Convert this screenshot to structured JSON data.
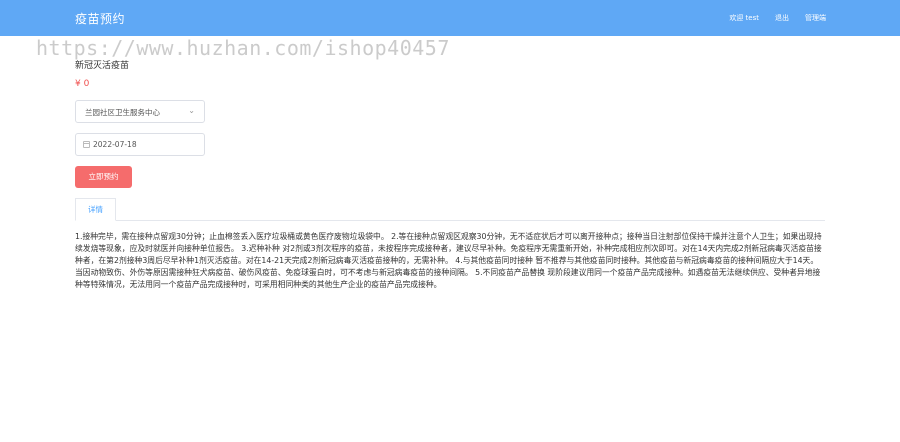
{
  "header": {
    "brand": "疫苗预约",
    "nav": {
      "welcome": "欢迎 test",
      "logout": "退出",
      "admin": "管理端"
    }
  },
  "watermark": "https://www.huzhan.com/ishop40457",
  "product": {
    "name": "新冠灭活疫苗",
    "price": "¥ 0"
  },
  "form": {
    "clinic_selected": "兰园社区卫生服务中心",
    "date_value": "2022-07-18",
    "book_label": "立即预约"
  },
  "tabs": {
    "detail_label": "详情"
  },
  "detail_text": "1.接种完毕，需在接种点留观30分钟；止血棉签丢入医疗垃圾桶或黄色医疗废物垃圾袋中。 2.等在接种点留观区观察30分钟，无不适症状后才可以离开接种点；接种当日注射部位保持干燥并注意个人卫生；如果出现持续发烧等现象，应及时就医并向接种单位报告。 3.迟种补种 对2剂或3剂次程序的疫苗，未按程序完成接种者，建议尽早补种。免疫程序无需重新开始，补种完成相应剂次即可。对在14天内完成2剂新冠病毒灭活疫苗接种者，在第2剂接种3周后尽早补种1剂灭活疫苗。对在14-21天完成2剂新冠病毒灭活疫苗接种的，无需补种。 4.与其他疫苗同时接种 暂不推荐与其他疫苗同时接种。其他疫苗与新冠病毒疫苗的接种间隔应大于14天。当因动物致伤、外伤等原因需接种狂犬病疫苗、破伤风疫苗、免疫球蛋白时，可不考虑与新冠病毒疫苗的接种间隔。 5.不同疫苗产品替换 现阶段建议用同一个疫苗产品完成接种。如遇疫苗无法继续供应、受种者异地接种等特殊情况，无法用同一个疫苗产品完成接种时，可采用相同种类的其他生产企业的疫苗产品完成接种。",
  "colors": {
    "header": "#5fa8f5",
    "price": "#f0504f",
    "book_button": "#f56c6c",
    "tab_active": "#409eff"
  },
  "icons": {
    "select_arrow": "chevron-down-icon",
    "date": "calendar-icon"
  }
}
